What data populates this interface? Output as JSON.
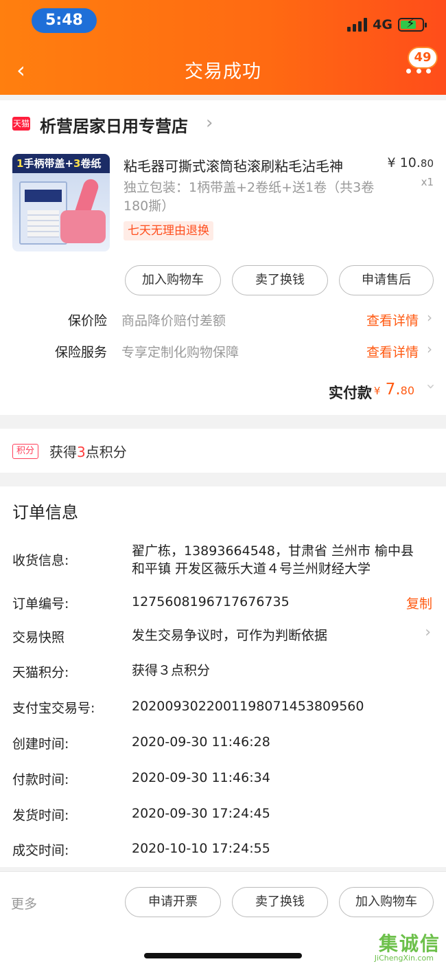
{
  "status_bar": {
    "time": "5:48",
    "network": "4G"
  },
  "header": {
    "title": "交易成功",
    "badge_count": "49"
  },
  "store": {
    "badge": "天猫",
    "name": "析营居家日用专营店",
    "product": {
      "image_banner_prefix": "1",
      "image_banner_mid": "手柄带盖+",
      "image_banner_num": "3",
      "image_banner_suffix": "卷纸",
      "title": "粘毛器可撕式滚筒毡滚刷粘毛沾毛神",
      "spec": "独立包装：1柄带盖+2卷纸+送1卷（共3卷180撕）",
      "tag": "七天无理由退换",
      "price_symbol": "¥",
      "price_int": "10.",
      "price_dec": "80",
      "quantity": "x1"
    },
    "actions": {
      "add_cart": "加入购物车",
      "resell": "卖了换钱",
      "after_sale": "申请售后"
    },
    "insurance": [
      {
        "label": "保价险",
        "desc": "商品降价赔付差额",
        "link": "查看详情"
      },
      {
        "label": "保险服务",
        "desc": "专享定制化购物保障",
        "link": "查看详情"
      }
    ],
    "paid": {
      "label": "实付款",
      "symbol": "¥",
      "int": " 7.",
      "dec": "80"
    }
  },
  "points": {
    "tag": "积分",
    "prefix": "获得",
    "num": "3",
    "suffix": "点积分"
  },
  "order": {
    "title": "订单信息",
    "rows": [
      {
        "label": "收货信息:",
        "value": "翟广栋，13893664548，甘肃省 兰州市 榆中县 和平镇 开发区薇乐大道４号兰州财经大学"
      },
      {
        "label": "订单编号:",
        "value": "1275608196717676735",
        "action": "复制"
      },
      {
        "label": "交易快照",
        "value": "发生交易争议时，可作为判断依据"
      },
      {
        "label": "天猫积分:",
        "value": "获得３点积分"
      },
      {
        "label": "支付宝交易号:",
        "value": "2020093022001198071453809560"
      },
      {
        "label": "创建时间:",
        "value": "2020-09-30 11:46:28"
      },
      {
        "label": "付款时间:",
        "value": "2020-09-30 11:46:34"
      },
      {
        "label": "发货时间:",
        "value": "2020-09-30 17:24:45"
      },
      {
        "label": "成交时间:",
        "value": "2020-10-10 17:24:55"
      }
    ]
  },
  "bottom_bar": {
    "more": "更多",
    "invoice": "申请开票",
    "resell": "卖了换钱",
    "add_cart": "加入购物车"
  },
  "watermark": {
    "main": "集诚信",
    "sub": "JiChengXin.com"
  },
  "colors": {
    "header_start": "#ff7f0f",
    "header_end": "#ff4d1a",
    "accent": "#ff5a12"
  }
}
